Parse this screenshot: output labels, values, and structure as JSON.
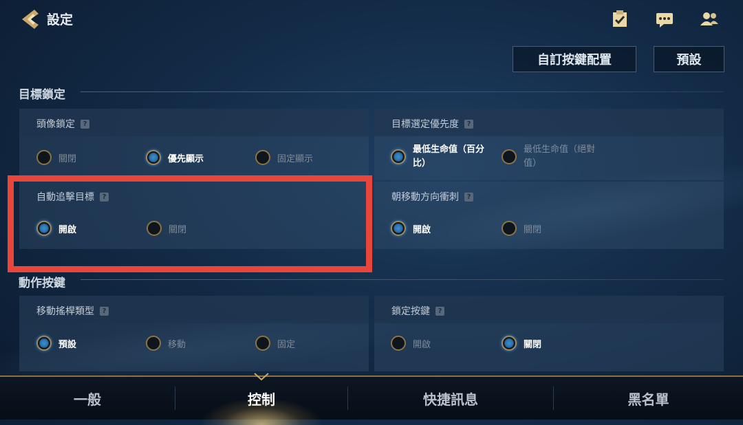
{
  "header": {
    "title": "設定",
    "icons": [
      "back-arrow-icon",
      "task-clipboard-icon",
      "chat-icon",
      "friends-icon"
    ]
  },
  "actions": {
    "custom_layout_label": "自訂按鍵配置",
    "default_label": "預設"
  },
  "sections": {
    "target_lock": {
      "title": "目標鎖定",
      "cards": {
        "avatar_lock": {
          "title": "頭像鎖定",
          "options": [
            "關閉",
            "優先顯示",
            "固定顯示"
          ],
          "selected": "優先顯示"
        },
        "target_priority": {
          "title": "目標選定優先度",
          "options": [
            "最低生命值（百分比）",
            "最低生命值（絕對值）"
          ],
          "selected": "最低生命值（百分比）"
        },
        "auto_chase": {
          "title": "自動追擊目標",
          "options": [
            "開啟",
            "關閉"
          ],
          "selected": "開啟"
        },
        "dash_direction": {
          "title": "朝移動方向衝刺",
          "options": [
            "開啟",
            "關閉"
          ],
          "selected": "開啟"
        }
      }
    },
    "action_buttons": {
      "title": "動作按鍵",
      "cards": {
        "joystick_type": {
          "title": "移動搖桿類型",
          "options": [
            "預設",
            "移動",
            "固定"
          ],
          "selected": "預設"
        },
        "lock_button": {
          "title": "鎖定按鍵",
          "options": [
            "開啟",
            "關閉"
          ],
          "selected": "關閉"
        }
      }
    }
  },
  "help_mark": "?",
  "bottom_nav": {
    "tabs": [
      "一般",
      "控制",
      "快捷訊息",
      "黑名單"
    ],
    "active": "控制"
  },
  "colors": {
    "accent_gold": "#8a7446",
    "radio_selected": "#3a8fd1",
    "highlight_box": "#e8463b"
  }
}
